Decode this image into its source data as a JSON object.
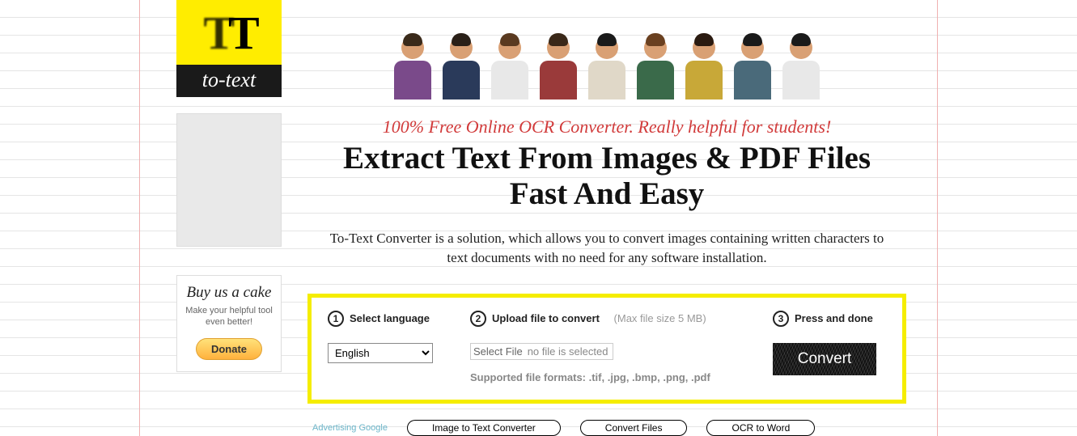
{
  "logo": {
    "top": "TT",
    "bottom": "to-text"
  },
  "donate": {
    "title": "Buy us a cake",
    "sub": "Make your helpful tool even better!",
    "button": "Donate"
  },
  "hero": {
    "tagline": "100% Free Online OCR Converter. Really helpful for students!",
    "headline": "Extract Text From Images & PDF Files Fast And Easy",
    "desc": "To-Text Converter is a solution, which allows you to convert images containing written characters to text documents with no need for any software installation."
  },
  "converter": {
    "step1": {
      "num": "1",
      "label": "Select language",
      "value": "English"
    },
    "step2": {
      "num": "2",
      "label": "Upload file to convert",
      "hint": "(Max file size 5 MB)",
      "button": "Select File",
      "status": "no file is selected",
      "supported": "Supported file formats: .tif, .jpg, .bmp, .png, .pdf"
    },
    "step3": {
      "num": "3",
      "label": "Press and done",
      "button": "Convert"
    }
  },
  "ads": {
    "label": "Advertising Google",
    "links": [
      "Image to Text Converter",
      "Convert Files",
      "OCR to Word"
    ]
  },
  "people_colors": [
    {
      "hair": "#3a2a1a",
      "shirt": "#7a4a8a"
    },
    {
      "hair": "#2a2018",
      "shirt": "#2a3a5a"
    },
    {
      "hair": "#5a3a20",
      "shirt": "#e8e8e8"
    },
    {
      "hair": "#3a2818",
      "shirt": "#9a3a3a"
    },
    {
      "hair": "#1a1a1a",
      "shirt": "#e0d8c8"
    },
    {
      "hair": "#6a4020",
      "shirt": "#3a6a4a"
    },
    {
      "hair": "#2a1a10",
      "shirt": "#c8a838"
    },
    {
      "hair": "#1a1a1a",
      "shirt": "#4a6a7a"
    },
    {
      "hair": "#1a1a1a",
      "shirt": "#e8e8e8"
    }
  ]
}
